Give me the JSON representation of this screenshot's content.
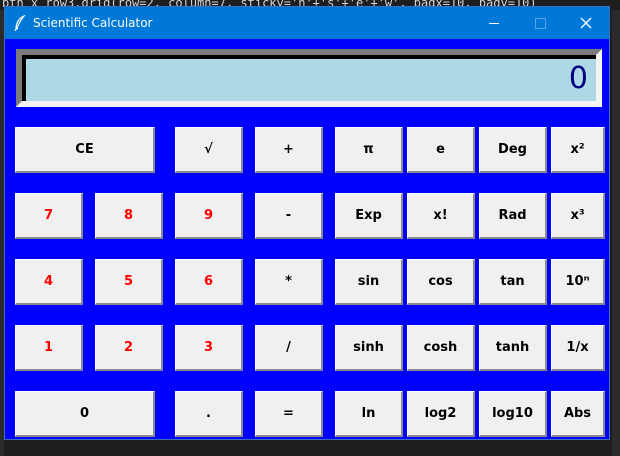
{
  "background": {
    "code_line": "btn_x_row3.grid(row=2, column=7, sticky='n'+'s'+'e'+'w', padx=10, pady=10)"
  },
  "window": {
    "title": "Scientific Calculator",
    "icon": "feather-icon",
    "controls": [
      "minimize",
      "maximize",
      "close"
    ]
  },
  "display": {
    "value": "0",
    "background": "#add8e6",
    "text_color": "#000080"
  },
  "colors": {
    "window_bg": "#0000ff",
    "titlebar": "#0078d7",
    "digit_text": "#ff0000",
    "button_face": "#f0f0f0"
  },
  "buttons": {
    "ce": "CE",
    "sqrt": "√",
    "plus": "+",
    "pi": "π",
    "e": "e",
    "deg": "Deg",
    "x2": "x²",
    "seven": "7",
    "eight": "8",
    "nine": "9",
    "minus": "-",
    "exp": "Exp",
    "fact": "x!",
    "rad": "Rad",
    "x3": "x³",
    "four": "4",
    "five": "5",
    "six": "6",
    "mul": "*",
    "sin": "sin",
    "cos": "cos",
    "tan": "tan",
    "tenpow": "10ⁿ",
    "one": "1",
    "two": "2",
    "three": "3",
    "div": "/",
    "sinh": "sinh",
    "cosh": "cosh",
    "tanh": "tanh",
    "inv": "1/x",
    "zero": "0",
    "dot": ".",
    "equals": "=",
    "ln": "ln",
    "log2": "log2",
    "log10": "log10",
    "abs": "Abs"
  }
}
